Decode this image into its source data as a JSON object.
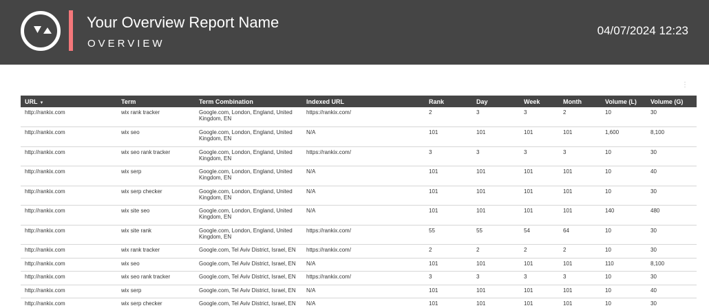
{
  "header": {
    "title": "Your Overview Report Name",
    "subtitle": "OVERVIEW",
    "datetime": "04/07/2024 12:23",
    "logo_icon": "play-triangles-logo-icon",
    "accent_color": "#f4777a",
    "background_color": "#454545"
  },
  "table": {
    "menu_icon": "kebab-menu-icon",
    "columns": [
      "URL",
      "Term",
      "Term Combination",
      "Indexed URL",
      "Rank",
      "Day",
      "Week",
      "Month",
      "Volume (L)",
      "Volume (G)"
    ],
    "sort_indicator": "▼",
    "rows": [
      [
        "http://rankix.com",
        "wix rank tracker",
        "Google.com, London, England, United Kingdom, EN",
        "https://rankix.com/",
        "2",
        "3",
        "3",
        "2",
        "10",
        "30"
      ],
      [
        "http://rankix.com",
        "wix seo",
        "Google.com, London, England, United Kingdom, EN",
        "N/A",
        "101",
        "101",
        "101",
        "101",
        "1,600",
        "8,100"
      ],
      [
        "http://rankix.com",
        "wix seo rank tracker",
        "Google.com, London, England, United Kingdom, EN",
        "https://rankix.com/",
        "3",
        "3",
        "3",
        "3",
        "10",
        "30"
      ],
      [
        "http://rankix.com",
        "wix serp",
        "Google.com, London, England, United Kingdom, EN",
        "N/A",
        "101",
        "101",
        "101",
        "101",
        "10",
        "40"
      ],
      [
        "http://rankix.com",
        "wix serp checker",
        "Google.com, London, England, United Kingdom, EN",
        "N/A",
        "101",
        "101",
        "101",
        "101",
        "10",
        "30"
      ],
      [
        "http://rankix.com",
        "wix site seo",
        "Google.com, London, England, United Kingdom, EN",
        "N/A",
        "101",
        "101",
        "101",
        "101",
        "140",
        "480"
      ],
      [
        "http://rankix.com",
        "wix site rank",
        "Google.com, London, England, United Kingdom, EN",
        "https://rankix.com/",
        "55",
        "55",
        "54",
        "64",
        "10",
        "30"
      ],
      [
        "http://rankix.com",
        "wix rank tracker",
        "Google.com, Tel Aviv District, Israel, EN",
        "https://rankix.com/",
        "2",
        "2",
        "2",
        "2",
        "10",
        "30"
      ],
      [
        "http://rankix.com",
        "wix seo",
        "Google.com, Tel Aviv District, Israel, EN",
        "N/A",
        "101",
        "101",
        "101",
        "101",
        "110",
        "8,100"
      ],
      [
        "http://rankix.com",
        "wix seo rank tracker",
        "Google.com, Tel Aviv District, Israel, EN",
        "https://rankix.com/",
        "3",
        "3",
        "3",
        "3",
        "10",
        "30"
      ],
      [
        "http://rankix.com",
        "wix serp",
        "Google.com, Tel Aviv District, Israel, EN",
        "N/A",
        "101",
        "101",
        "101",
        "101",
        "10",
        "40"
      ],
      [
        "http://rankix.com",
        "wix serp checker",
        "Google.com, Tel Aviv District, Israel, EN",
        "N/A",
        "101",
        "101",
        "101",
        "101",
        "10",
        "30"
      ]
    ]
  }
}
